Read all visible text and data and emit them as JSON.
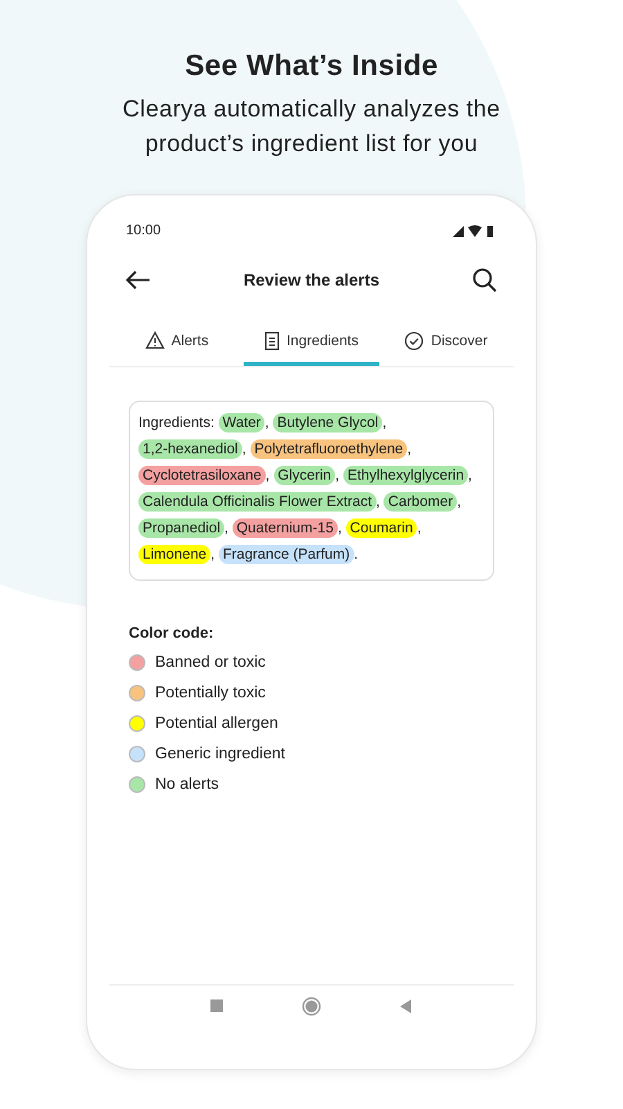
{
  "headline": {
    "title": "See What’s Inside",
    "subtitle": "Clearya automatically analyzes the product’s ingredient list for you"
  },
  "status_bar": {
    "time": "10:00"
  },
  "app_bar": {
    "title": "Review the alerts"
  },
  "tabs": [
    {
      "label": "Alerts",
      "kind": "warning",
      "selected": false
    },
    {
      "label": "Ingredients",
      "kind": "document",
      "selected": true
    },
    {
      "label": "Discover",
      "kind": "check",
      "selected": false
    }
  ],
  "ingredients": {
    "label": "Ingredients:",
    "items": [
      {
        "name": "Water",
        "color": "#a8e6a8",
        "punct": ","
      },
      {
        "name": "Butylene Glycol",
        "color": "#a8e6a8",
        "punct": ","
      },
      {
        "name": "1,2-hexanediol",
        "color": "#a8e6a8",
        "punct": ","
      },
      {
        "name": "Polytetrafluoroethylene",
        "color": "#f7c37f",
        "punct": ","
      },
      {
        "name": "Cyclotetrasiloxane",
        "color": "#f4a0a0",
        "punct": ","
      },
      {
        "name": "Glycerin",
        "color": "#a8e6a8",
        "punct": ","
      },
      {
        "name": "Ethylhexylglycerin",
        "color": "#a8e6a8",
        "punct": ","
      },
      {
        "name": "Calendula Officinalis Flower Extract",
        "color": "#a8e6a8",
        "punct": ","
      },
      {
        "name": "Carbomer",
        "color": "#a8e6a8",
        "punct": ","
      },
      {
        "name": "Propanediol",
        "color": "#a8e6a8",
        "punct": ","
      },
      {
        "name": "Quaternium-15",
        "color": "#f4a0a0",
        "punct": ","
      },
      {
        "name": "Coumarin",
        "color": "#ffff00",
        "punct": ","
      },
      {
        "name": "Limonene",
        "color": "#ffff00",
        "punct": ","
      },
      {
        "name": "Fragrance (Parfum)",
        "color": "#c6e2fb",
        "punct": "."
      }
    ]
  },
  "legend": {
    "title": "Color code:",
    "items": [
      {
        "label": "Banned or toxic",
        "color": "#f4a0a0"
      },
      {
        "label": "Potentially toxic",
        "color": "#f7c37f"
      },
      {
        "label": "Potential allergen",
        "color": "#ffff00"
      },
      {
        "label": "Generic ingredient",
        "color": "#c6e2fb"
      },
      {
        "label": "No alerts",
        "color": "#a8e6a8"
      }
    ]
  }
}
